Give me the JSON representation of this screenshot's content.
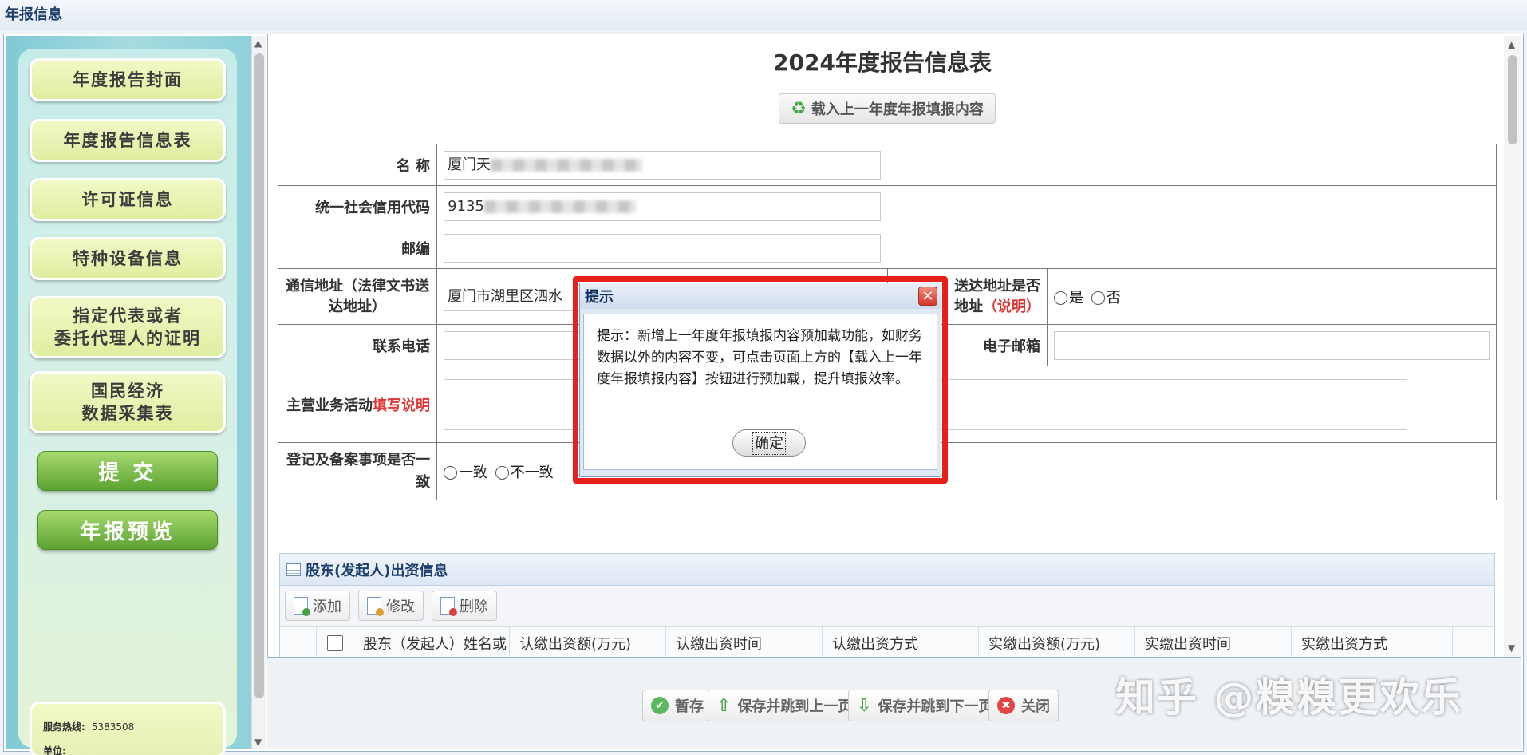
{
  "window": {
    "title": "年报信息"
  },
  "sidebar": {
    "items": [
      {
        "label": "年度报告封面"
      },
      {
        "label": "年度报告信息表"
      },
      {
        "label": "许可证信息"
      },
      {
        "label": "特种设备信息"
      },
      {
        "label": "指定代表或者\n委托代理人的证明"
      },
      {
        "label": "国民经济\n数据采集表"
      }
    ],
    "submit_label": "提 交",
    "preview_label": "年报预览",
    "hotline_label": "服务热线:",
    "hotline_value": "5383508",
    "unit_label": "单位:"
  },
  "main": {
    "title": "2024年度报告信息表",
    "load_button": "载入上一年度年报填报内容",
    "form": {
      "name_label": "名 称",
      "name_value": "厦门天",
      "credit_label": "统一社会信用代码",
      "credit_value": "9135",
      "postcode_label": "邮编",
      "postcode_value": "",
      "address_label": "通信地址（法律文书送达地址）",
      "address_value": "厦门市湖里区泗水",
      "address_same_label": "送达地址是否",
      "address_same_label2": "地址",
      "address_same_note": "（说明）",
      "yes_label": "是",
      "no_label": "否",
      "phone_label": "联系电话",
      "phone_value": "",
      "email_label": "电子邮箱",
      "email_value": "",
      "business_label": "主营业务活动",
      "business_note": "填写说明",
      "registry_label": "登记及备案事项是否一致",
      "consistent_label": "一致",
      "inconsistent_label": "不一致"
    },
    "shareholders": {
      "title": "股东(发起人)出资信息",
      "add_label": "添加",
      "edit_label": "修改",
      "delete_label": "删除",
      "columns": [
        "股东（发起人）姓名或",
        "认缴出资额(万元)",
        "认缴出资时间",
        "认缴出资方式",
        "实缴出资额(万元)",
        "实缴出资时间",
        "实缴出资方式"
      ]
    }
  },
  "footer": {
    "save_temp": "暂存",
    "save_prev": "保存并跳到上一页",
    "save_next": "保存并跳到下一页",
    "close": "关闭"
  },
  "watermark": "知乎 @糗糗更欢乐",
  "modal": {
    "title": "提示",
    "message": "提示：新增上一年度年报填报内容预加载功能，如财务数据以外的内容不变，可点击页面上方的【载入上一年度年报填报内容】按钮进行预加载，提升填报效率。",
    "ok_label": "确定"
  },
  "colors": {
    "highlight": "#e8201c",
    "accent_red_text": "#e03535",
    "header_blue": "#1d3f6b",
    "sidebar_teal": "#7fcad6",
    "button_green": "#5ca332"
  }
}
